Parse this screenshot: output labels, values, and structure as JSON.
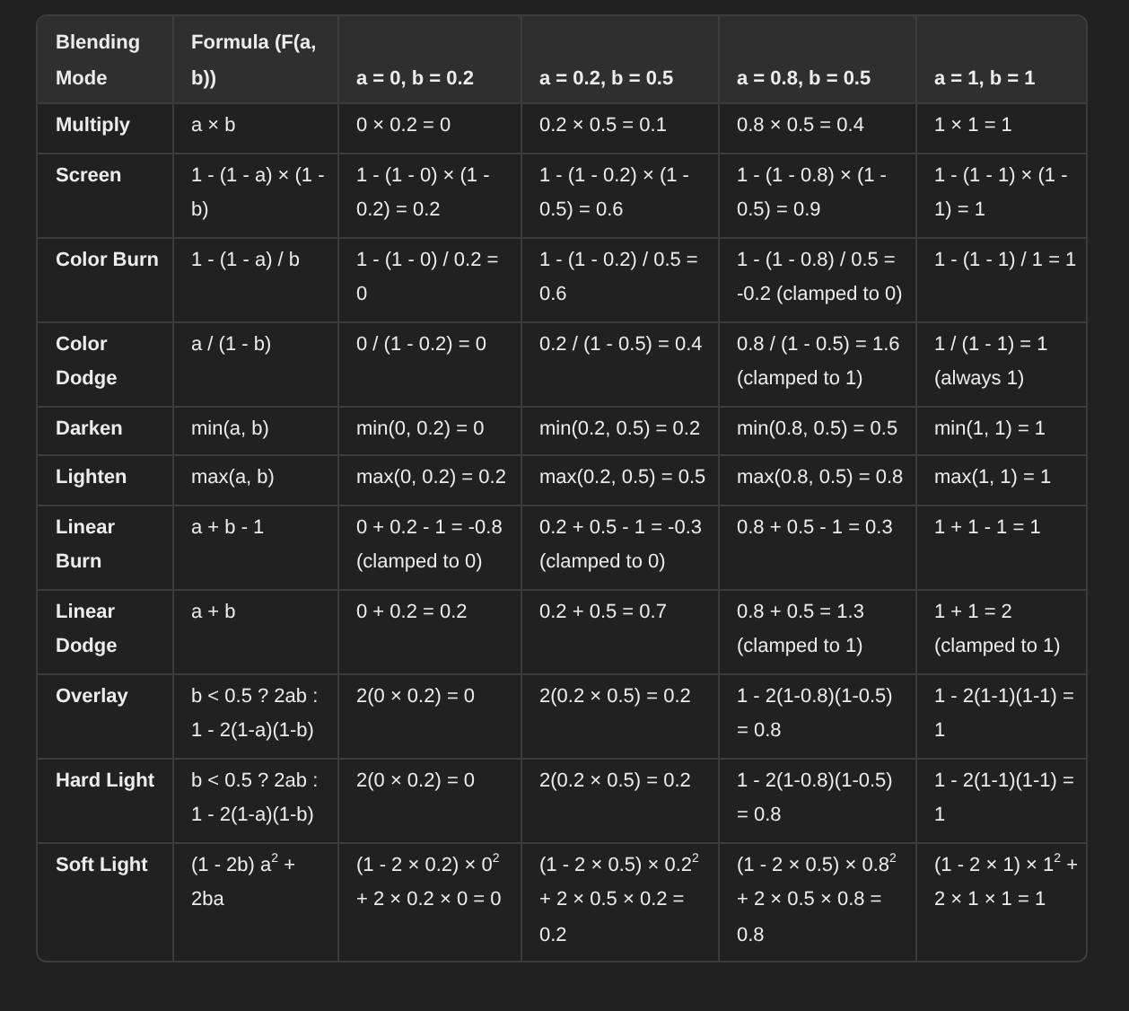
{
  "table": {
    "columns": [
      "Blending Mode",
      "Formula (F(a, b))",
      "a = 0, b = 0.2",
      "a = 0.2, b = 0.5",
      "a = 0.8, b = 0.5",
      "a = 1, b = 1"
    ],
    "rows": [
      [
        "Multiply",
        "a × b",
        "0 × 0.2 = 0",
        "0.2 × 0.5 = 0.1",
        "0.8 × 0.5 = 0.4",
        "1 × 1 = 1"
      ],
      [
        "Screen",
        "1 - (1 - a) × (1 - b)",
        "1 - (1 - 0) × (1 - 0.2) = 0.2",
        "1 - (1 - 0.2) × (1 - 0.5) = 0.6",
        "1 - (1 - 0.8) × (1 - 0.5) = 0.9",
        "1 - (1 - 1) × (1 - 1) = 1"
      ],
      [
        "Color Burn",
        "1 - (1 - a) / b",
        "1 - (1 - 0) / 0.2 = 0",
        "1 - (1 - 0.2) / 0.5 = 0.6",
        "1 - (1 - 0.8) / 0.5 = -0.2 (clamped to 0)",
        "1 - (1 - 1) / 1 = 1"
      ],
      [
        "Color Dodge",
        "a / (1 - b)",
        "0 / (1 - 0.2) = 0",
        "0.2 / (1 - 0.5) = 0.4",
        "0.8 / (1 - 0.5) = 1.6 (clamped to 1)",
        "1 / (1 - 1) = 1 (always 1)"
      ],
      [
        "Darken",
        "min(a, b)",
        "min(0, 0.2) = 0",
        "min(0.2, 0.5) = 0.2",
        "min(0.8, 0.5) = 0.5",
        "min(1, 1) = 1"
      ],
      [
        "Lighten",
        "max(a, b)",
        "max(0, 0.2) = 0.2",
        "max(0.2, 0.5) = 0.5",
        "max(0.8, 0.5) = 0.8",
        "max(1, 1) = 1"
      ],
      [
        "Linear Burn",
        "a + b - 1",
        "0 + 0.2 - 1 = -0.8 (clamped to 0)",
        "0.2 + 0.5 - 1 = -0.3 (clamped to 0)",
        "0.8 + 0.5 - 1 = 0.3",
        "1 + 1 - 1 = 1"
      ],
      [
        "Linear Dodge",
        "a + b",
        "0 + 0.2 = 0.2",
        "0.2 + 0.5 = 0.7",
        "0.8 + 0.5 = 1.3 (clamped to 1)",
        "1 + 1 = 2 (clamped to 1)"
      ],
      [
        "Overlay",
        "b < 0.5 ? 2ab : 1 - 2(1-a)(1-b)",
        "2(0 × 0.2) = 0",
        "2(0.2 × 0.5) = 0.2",
        "1 - 2(1-0.8)(1-0.5) = 0.8",
        "1 - 2(1-1)(1-1) = 1"
      ],
      [
        "Hard Light",
        "b < 0.5 ? 2ab : 1 - 2(1-a)(1-b)",
        "2(0 × 0.2) = 0",
        "2(0.2 × 0.5) = 0.2",
        "1 - 2(1-0.8)(1-0.5) = 0.8",
        "1 - 2(1-1)(1-1) = 1"
      ],
      [
        "Soft Light",
        "(1 - 2b) a$^{2}$ + 2ba",
        "(1 - 2 × 0.2) × 0$^{2}$ + 2 × 0.2 × 0 = 0",
        "(1 - 2 × 0.5) × 0.2$^{2}$ + 2 × 0.5 × 0.2 = 0.2",
        "(1 - 2 × 0.5) × 0.8$^{2}$ + 2 × 0.5 × 0.8 = 0.8",
        "(1 - 2 × 1) × 1$^{2}$ + 2 × 1 × 1 = 1"
      ]
    ]
  }
}
